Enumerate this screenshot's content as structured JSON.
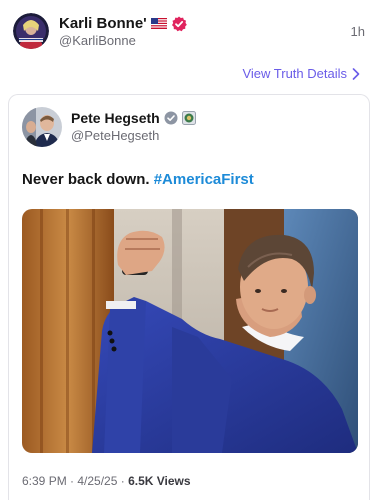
{
  "post": {
    "author_name": "Karli Bonne'",
    "author_handle": "@KarliBonne",
    "time_ago": "1h",
    "truth_details_label": "View Truth Details",
    "icons": [
      "us-flag-icon",
      "verified-badge-icon",
      "chevron-right-icon"
    ]
  },
  "quoted": {
    "author_name": "Pete Hegseth",
    "author_handle": "@PeteHegseth",
    "text_plain": "Never back down. ",
    "hashtag": "#AmericaFirst",
    "icons": [
      "verified-check-icon",
      "government-seal-icon"
    ]
  },
  "meta": {
    "datetime": "6:39 PM · 4/25/25 · ",
    "views": "6.5K Views"
  },
  "colors": {
    "link_purple": "#6a5ce8",
    "hashtag_blue": "#1d8bd8",
    "verified_red": "#e0245e",
    "suit_blue": "#2b3ea3"
  }
}
